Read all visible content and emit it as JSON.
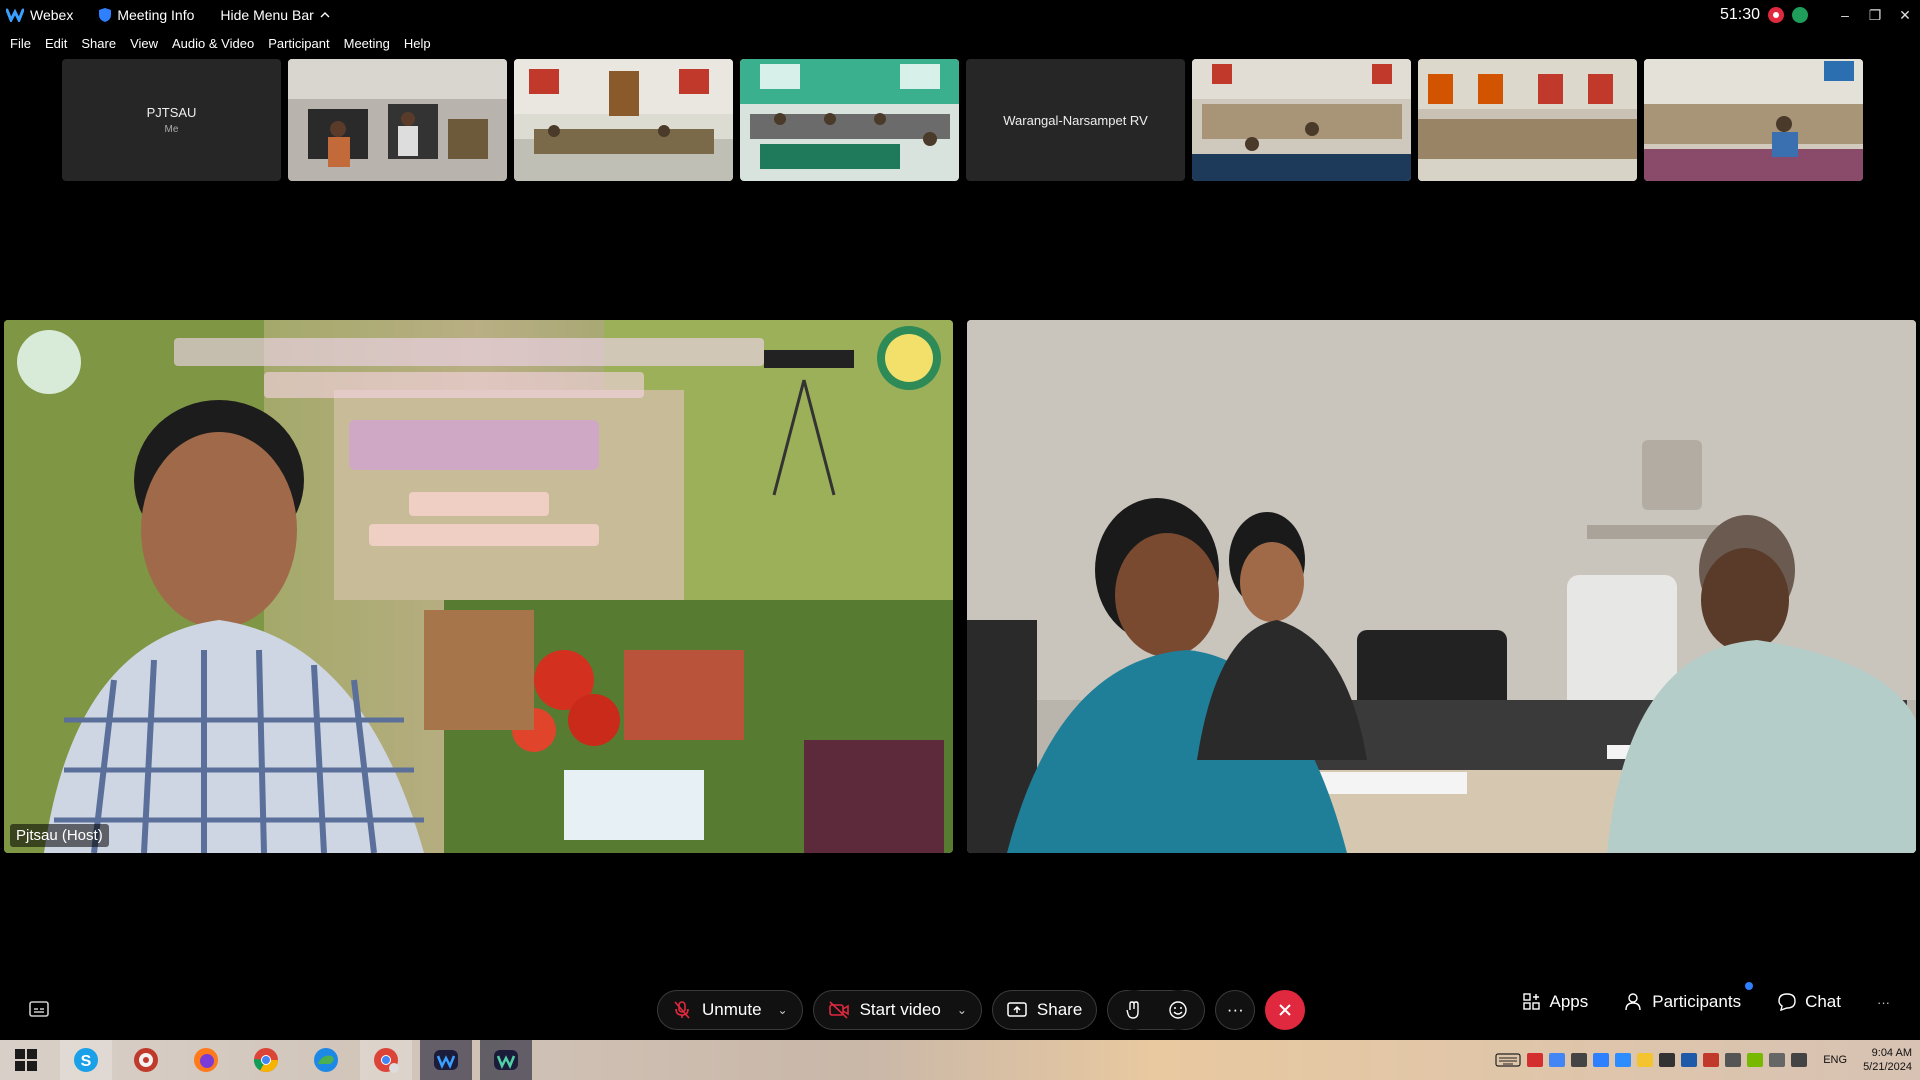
{
  "titlebar": {
    "app_name": "Webex",
    "meeting_info": "Meeting Info",
    "hide_menu": "Hide Menu Bar",
    "timer": "51:30",
    "minimize": "–",
    "restore": "❐",
    "close": "✕"
  },
  "menu": [
    "File",
    "Edit",
    "Share",
    "View",
    "Audio & Video",
    "Participant",
    "Meeting",
    "Help"
  ],
  "thumbnails": {
    "self_name": "PJTSAU",
    "self_sub": "Me",
    "warangal_name": "Warangal-Narsampet RV"
  },
  "main": {
    "left_label": "Pjtsau (Host)"
  },
  "controls": {
    "unmute": "Unmute",
    "start_video": "Start video",
    "share": "Share",
    "more": "···",
    "apps": "Apps",
    "participants": "Participants",
    "chat": "Chat",
    "overflow": "···"
  },
  "taskbar": {
    "lang": "ENG",
    "time": "9:04 AM",
    "date": "5/21/2024"
  },
  "colors": {
    "end_call": "#e0293e",
    "recording": "#e0293e",
    "status": "#1e9e5a",
    "notification": "#2f80ff"
  }
}
